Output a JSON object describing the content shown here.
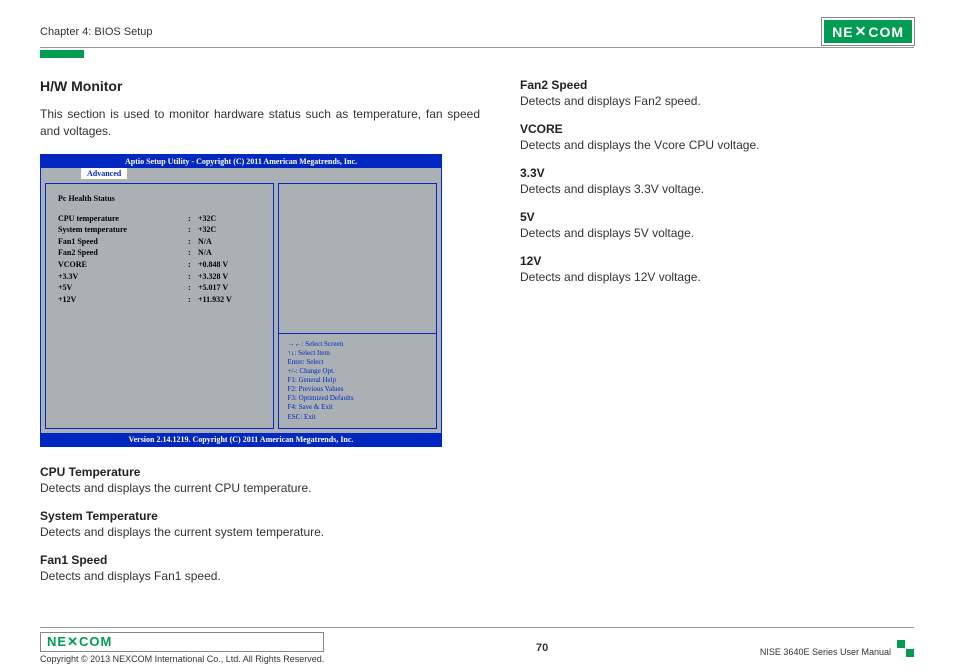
{
  "header": {
    "chapter": "Chapter 4: BIOS Setup",
    "logo_text": "NEXCOM"
  },
  "section": {
    "title": "H/W Monitor",
    "intro": "This section is used to monitor hardware status such as temperature, fan speed and voltages."
  },
  "bios": {
    "title": "Aptio Setup Utility - Copyright (C) 2011 American Megatrends, Inc.",
    "tab": "Advanced",
    "status_header": "Pc Health Status",
    "rows": [
      {
        "label": "CPU temperature",
        "value": "+32C"
      },
      {
        "label": "System temperature",
        "value": "+32C"
      },
      {
        "label": "Fan1 Speed",
        "value": "N/A"
      },
      {
        "label": "Fan2 Speed",
        "value": "N/A"
      },
      {
        "label": "VCORE",
        "value": "+0.848 V"
      },
      {
        "label": "+3.3V",
        "value": "+3.328 V"
      },
      {
        "label": "+5V",
        "value": "+5.017 V"
      },
      {
        "label": "+12V",
        "value": "+11.932 V"
      }
    ],
    "help": [
      "→←: Select Screen",
      "↑↓: Select Item",
      "Enter: Select",
      "+/-: Change Opt.",
      "F1: General Help",
      "F2: Previous Values",
      "F3: Optimized Defaults",
      "F4: Save & Exit",
      "ESC: Exit"
    ],
    "footer": "Version 2.14.1219. Copyright (C) 2011 American Megatrends, Inc."
  },
  "left_descriptions": [
    {
      "title": "CPU Temperature",
      "text": "Detects and displays the current CPU temperature."
    },
    {
      "title": "System Temperature",
      "text": "Detects and displays the current system temperature."
    },
    {
      "title": "Fan1 Speed",
      "text": "Detects and displays Fan1 speed."
    }
  ],
  "right_descriptions": [
    {
      "title": "Fan2 Speed",
      "text": "Detects and displays Fan2 speed."
    },
    {
      "title": "VCORE",
      "text": "Detects and displays the Vcore CPU voltage."
    },
    {
      "title": "3.3V",
      "text": "Detects and displays 3.3V voltage."
    },
    {
      "title": "5V",
      "text": "Detects and displays 5V voltage."
    },
    {
      "title": "12V",
      "text": "Detects and displays 12V voltage."
    }
  ],
  "footer": {
    "copyright": "Copyright © 2013 NEXCOM International Co., Ltd. All Rights Reserved.",
    "page": "70",
    "manual": "NISE 3640E Series User Manual",
    "logo_text": "NEXCOM"
  }
}
